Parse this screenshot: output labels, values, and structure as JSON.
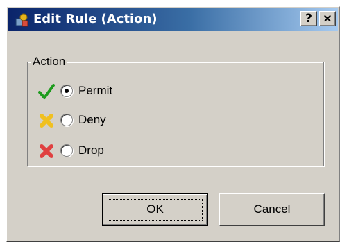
{
  "window": {
    "title": "Edit Rule (Action)",
    "help_label": "?",
    "close_label": "×"
  },
  "group": {
    "legend": "Action",
    "options": [
      {
        "label": "Permit",
        "selected": true,
        "icon": "checkmark-icon",
        "icon_color": "#1e9b1e"
      },
      {
        "label": "Deny",
        "selected": false,
        "icon": "cross-icon",
        "icon_color": "#f0c020"
      },
      {
        "label": "Drop",
        "selected": false,
        "icon": "cross-icon",
        "icon_color": "#e04040"
      }
    ]
  },
  "buttons": {
    "ok": {
      "accel": "O",
      "rest": "K"
    },
    "cancel": {
      "accel": "C",
      "rest": "ancel"
    }
  },
  "colors": {
    "dialog_bg": "#d4d0c8",
    "titlebar_start": "#0a246a",
    "titlebar_end": "#a6caf0"
  }
}
